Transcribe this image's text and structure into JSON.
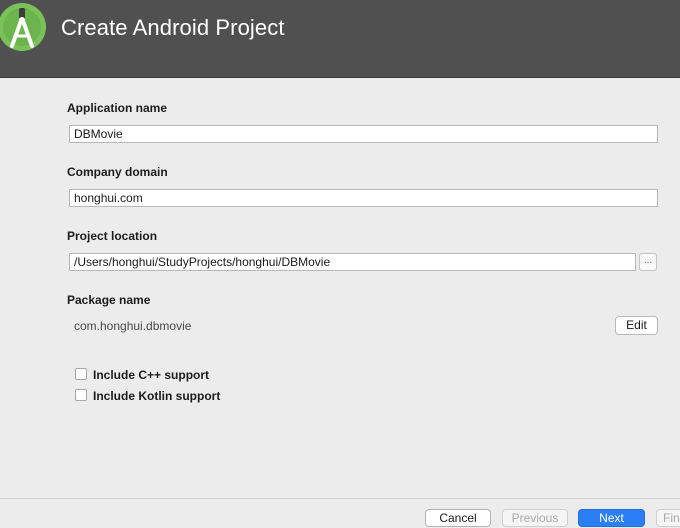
{
  "window": {
    "title": "Create Android Project",
    "logo_icon": "android-studio-logo-icon",
    "accent_color": "#78c257"
  },
  "form": {
    "app_name": {
      "label": "Application name",
      "value": "DBMovie"
    },
    "company_domain": {
      "label": "Company domain",
      "value": "honghui.com"
    },
    "project_location": {
      "label": "Project location",
      "value": "/Users/honghui/StudyProjects/honghui/DBMovie",
      "browse_label": "..."
    },
    "package_name": {
      "label": "Package name",
      "value": "com.honghui.dbmovie",
      "edit_label": "Edit"
    },
    "options": [
      {
        "label": "Include C++ support",
        "checked": false
      },
      {
        "label": "Include Kotlin support",
        "checked": false
      }
    ]
  },
  "footer": {
    "cancel": "Cancel",
    "previous": "Previous",
    "next": "Next",
    "finish": "Finish",
    "primary_color": "#2c7ef4"
  }
}
